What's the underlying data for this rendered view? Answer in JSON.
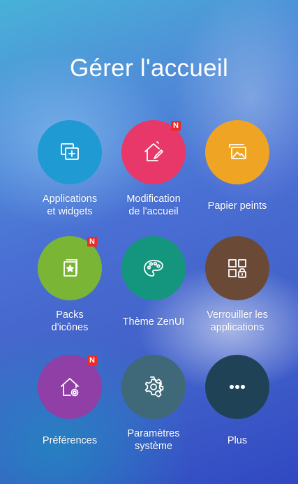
{
  "header": {
    "title": "Gérer l'accueil"
  },
  "tiles": [
    {
      "key": "apps-widgets",
      "label_line1": "Applications",
      "label_line2": "et widgets",
      "color": "#1f9ad3",
      "icon": "add-widget-icon",
      "badge": ""
    },
    {
      "key": "home-edit",
      "label_line1": "Modification",
      "label_line2": "de l'accueil",
      "color": "#e8386a",
      "icon": "home-edit-icon",
      "badge": "N"
    },
    {
      "key": "wallpapers",
      "label_line1": "Papier peints",
      "label_line2": "",
      "color": "#f0a423",
      "icon": "wallpaper-icon",
      "badge": ""
    },
    {
      "key": "icon-packs",
      "label_line1": "Packs",
      "label_line2": "d'icônes",
      "color": "#7ab536",
      "icon": "icon-pack-icon",
      "badge": "N"
    },
    {
      "key": "zenui-theme",
      "label_line1": "Thème ZenUI",
      "label_line2": "",
      "color": "#14957e",
      "icon": "palette-icon",
      "badge": ""
    },
    {
      "key": "lock-apps",
      "label_line1": "Verrouiller les",
      "label_line2": "applications",
      "color": "#6a4a37",
      "icon": "app-lock-icon",
      "badge": ""
    },
    {
      "key": "preferences",
      "label_line1": "Préférences",
      "label_line2": "",
      "color": "#8f3fa6",
      "icon": "home-settings-icon",
      "badge": "N"
    },
    {
      "key": "system-settings",
      "label_line1": "Paramètres",
      "label_line2": "système",
      "color": "#3f6978",
      "icon": "gear-icon",
      "badge": ""
    },
    {
      "key": "more",
      "label_line1": "Plus",
      "label_line2": "",
      "color": "#1f4257",
      "icon": "more-dots-icon",
      "badge": ""
    }
  ]
}
